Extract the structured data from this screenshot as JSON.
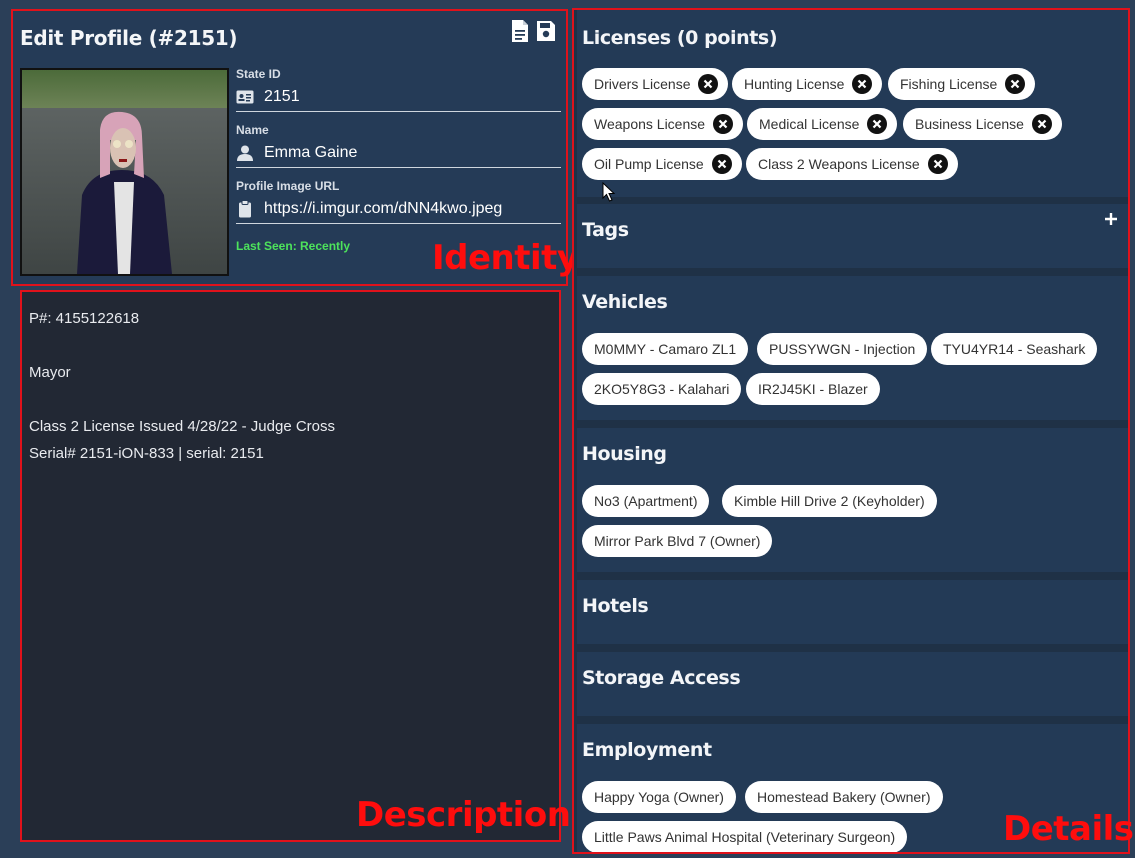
{
  "identity": {
    "title": "Edit Profile (#2151)",
    "state_id_label": "State ID",
    "state_id": "2151",
    "name_label": "Name",
    "name": "Emma Gaine",
    "image_url_label": "Profile Image URL",
    "image_url": "https://i.imgur.com/dNN4kwo.jpeg",
    "last_seen": "Last Seen: Recently",
    "annotation": "Identity"
  },
  "description": {
    "lines": [
      "P#: 4155122618",
      "",
      "Mayor",
      "",
      "Class 2 License Issued 4/28/22 - Judge Cross",
      "Serial# 2151-iON-833 | serial: 2151"
    ],
    "annotation": "Description"
  },
  "details": {
    "annotation": "Details",
    "licenses": {
      "title": "Licenses (0 points)",
      "items": [
        "Drivers License",
        "Hunting License",
        "Fishing License",
        "Weapons License",
        "Medical License",
        "Business License",
        "Oil Pump License",
        "Class 2 Weapons License"
      ]
    },
    "tags": {
      "title": "Tags"
    },
    "vehicles": {
      "title": "Vehicles",
      "items": [
        "M0MMY - Camaro ZL1",
        "PUSSYWGN - Injection",
        "TYU4YR14 - Seashark",
        "2KO5Y8G3 - Kalahari",
        "IR2J45KI - Blazer"
      ]
    },
    "housing": {
      "title": "Housing",
      "items": [
        "No3 (Apartment)",
        "Kimble Hill Drive 2 (Keyholder)",
        "Mirror Park Blvd 7 (Owner)"
      ]
    },
    "hotels": {
      "title": "Hotels"
    },
    "storage": {
      "title": "Storage Access"
    },
    "employment": {
      "title": "Employment",
      "items": [
        "Happy Yoga (Owner)",
        "Homestead Bakery (Owner)",
        "Little Paws Animal Hospital (Veterinary Surgeon)"
      ]
    }
  }
}
